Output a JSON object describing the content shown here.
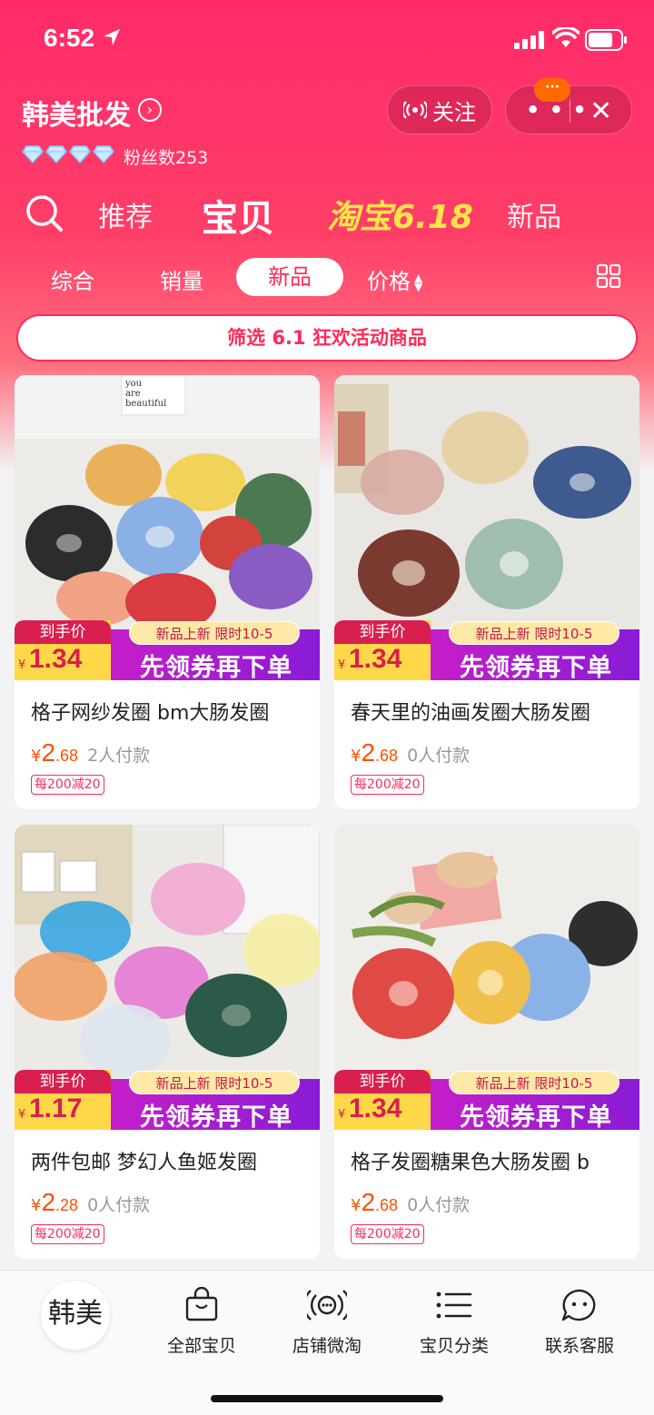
{
  "status_bar": {
    "time": "6:52"
  },
  "header": {
    "shop_name": "韩美批发",
    "fans": "粉丝数253",
    "follow_label": "关注",
    "badge": "···"
  },
  "main_tabs": [
    {
      "label": "推荐"
    },
    {
      "label": "宝贝"
    },
    {
      "label": "淘宝6.18"
    },
    {
      "label": "新品"
    }
  ],
  "sub_tabs": [
    {
      "label": "综合"
    },
    {
      "label": "销量"
    },
    {
      "label": "新品"
    },
    {
      "label": "价格"
    }
  ],
  "filter_bar": "筛选 6.1 狂欢活动商品",
  "products": [
    {
      "promo_label": "到手价",
      "promo_price": "1.34",
      "promo_tag": "新品上新 限时10-5",
      "promo_cta": "先领券再下单",
      "title": "格子网纱发圈 bm大肠发圈",
      "price_int": "2",
      "price_dec": ".68",
      "sold": "2人付款",
      "coupon": "每200减20"
    },
    {
      "promo_label": "到手价",
      "promo_price": "1.34",
      "promo_tag": "新品上新 限时10-5",
      "promo_cta": "先领券再下单",
      "title": "春天里的油画发圈大肠发圈",
      "price_int": "2",
      "price_dec": ".68",
      "sold": "0人付款",
      "coupon": "每200减20"
    },
    {
      "promo_label": "到手价",
      "promo_price": "1.17",
      "promo_tag": "新品上新 限时10-5",
      "promo_cta": "先领券再下单",
      "title": "两件包邮 梦幻人鱼姬发圈",
      "price_int": "2",
      "price_dec": ".28",
      "sold": "0人付款",
      "coupon": "每200减20"
    },
    {
      "promo_label": "到手价",
      "promo_price": "1.34",
      "promo_tag": "新品上新 限时10-5",
      "promo_cta": "先领券再下单",
      "title": "格子发圈糖果色大肠发圈 b",
      "price_int": "2",
      "price_dec": ".68",
      "sold": "0人付款",
      "coupon": "每200减20"
    }
  ],
  "photo_text": "you\nare\nbeautiful",
  "tabbar": {
    "logo": "韩美",
    "items": [
      {
        "label": "全部宝贝",
        "icon": "bag-icon"
      },
      {
        "label": "店铺微淘",
        "icon": "broadcast-icon"
      },
      {
        "label": "宝贝分类",
        "icon": "list-icon"
      },
      {
        "label": "联系客服",
        "icon": "chat-icon"
      }
    ]
  },
  "colors": {
    "brand": "#ff2a5a",
    "price": "#ff5000",
    "promo_purple": "#8a1cd6",
    "promo_yellow": "#ffd84a"
  }
}
